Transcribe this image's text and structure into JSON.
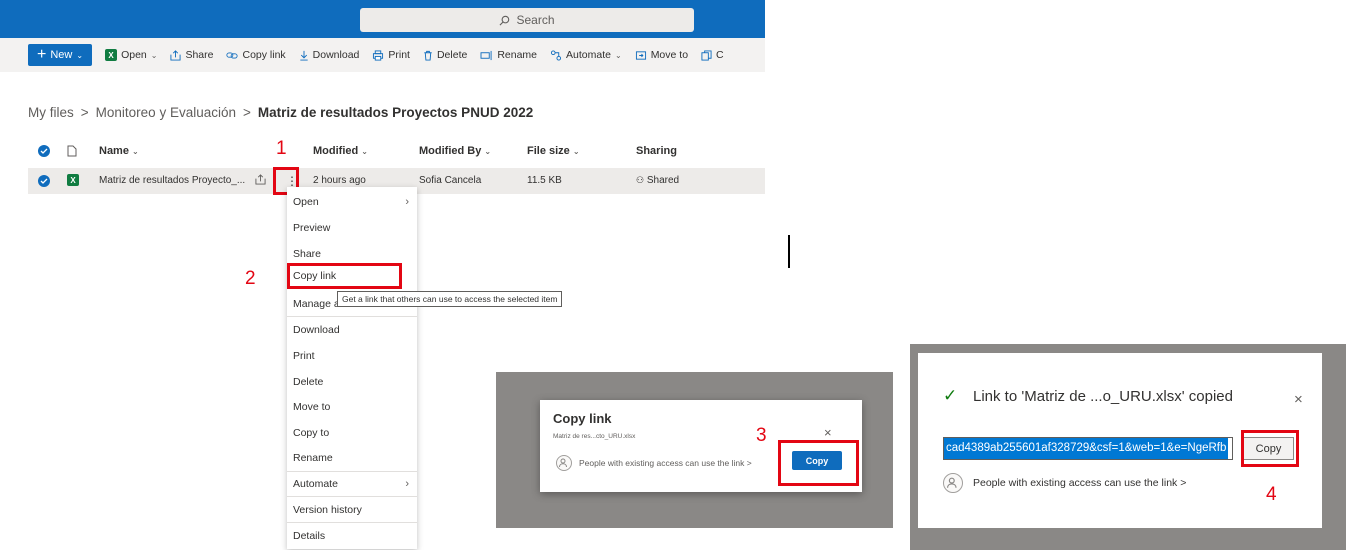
{
  "search": {
    "placeholder": "Search"
  },
  "toolbar": {
    "new_label": "New",
    "items": [
      {
        "label": "Open",
        "icon": "excel-icon",
        "has_chevron": true
      },
      {
        "label": "Share",
        "icon": "share-icon",
        "has_chevron": false
      },
      {
        "label": "Copy link",
        "icon": "link-icon",
        "has_chevron": false
      },
      {
        "label": "Download",
        "icon": "download-icon",
        "has_chevron": false
      },
      {
        "label": "Print",
        "icon": "print-icon",
        "has_chevron": false
      },
      {
        "label": "Delete",
        "icon": "trash-icon",
        "has_chevron": false
      },
      {
        "label": "Rename",
        "icon": "rename-icon",
        "has_chevron": false
      },
      {
        "label": "Automate",
        "icon": "automate-icon",
        "has_chevron": true
      },
      {
        "label": "Move to",
        "icon": "move-icon",
        "has_chevron": false
      },
      {
        "label": "C",
        "icon": "copy-icon",
        "has_chevron": false
      }
    ]
  },
  "breadcrumb": {
    "items": [
      "My files",
      "Monitoreo y Evaluación"
    ],
    "separator": ">",
    "current": "Matriz de resultados Proyectos PNUD 2022"
  },
  "file_list": {
    "columns": {
      "name": "Name",
      "modified": "Modified",
      "modified_by": "Modified By",
      "file_size": "File size",
      "sharing": "Sharing"
    },
    "rows": [
      {
        "name": "Matriz de resultados Proyecto_...",
        "modified": "2 hours ago",
        "modified_by": "Sofia Cancela",
        "file_size": "11.5 KB",
        "sharing": "Shared"
      }
    ]
  },
  "context_menu": {
    "items": [
      {
        "label": "Open",
        "submenu": true
      },
      {
        "label": "Preview",
        "submenu": false
      },
      {
        "label": "Share",
        "submenu": false
      },
      {
        "label": "Copy link",
        "submenu": false
      },
      {
        "label": "Manage a",
        "submenu": false
      },
      {
        "label": "Download",
        "submenu": false
      },
      {
        "label": "Print",
        "submenu": false
      },
      {
        "label": "Delete",
        "submenu": false
      },
      {
        "label": "Move to",
        "submenu": false
      },
      {
        "label": "Copy to",
        "submenu": false
      },
      {
        "label": "Rename",
        "submenu": false
      },
      {
        "label": "Automate",
        "submenu": true
      },
      {
        "label": "Version history",
        "submenu": false
      },
      {
        "label": "Details",
        "submenu": false
      }
    ]
  },
  "tooltip": {
    "text": "Get a link that others can use to access the selected item"
  },
  "annotations": {
    "n1": "1",
    "n2": "2",
    "n3": "3",
    "n4": "4",
    "color": "#e30613"
  },
  "copy_dialog": {
    "title": "Copy link",
    "subtitle": "Matriz de res...cto_URU.xlsx",
    "people_text": "People with existing access can use the link",
    "people_chevron": ">",
    "copy_label": "Copy",
    "close": "×"
  },
  "copied_dialog": {
    "title": "Link to 'Matriz de ...o_URU.xlsx' copied",
    "link_value": "cad4389ab255601af328729&csf=1&web=1&e=NgeRfb",
    "copy_label": "Copy",
    "people_text": "People with existing access can use the link",
    "people_chevron": ">",
    "close": "×",
    "check": "✓"
  },
  "colors": {
    "accent": "#0f6cbd",
    "selected_row": "#edebe9",
    "link_highlight": "#0078d4",
    "success": "#107c10"
  }
}
